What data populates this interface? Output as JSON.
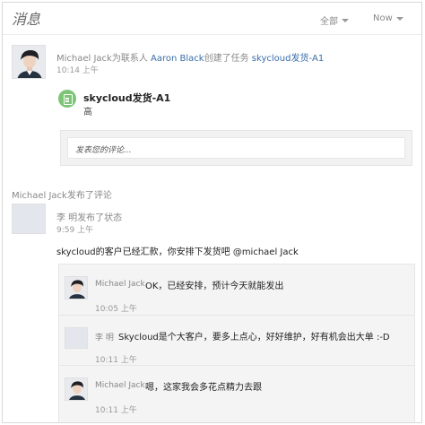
{
  "header": {
    "title": "消息",
    "filter_all": "全部",
    "filter_now": "Now"
  },
  "notification_1": {
    "actor": "Michael Jack",
    "action_prefix": "为联系人",
    "contact": "Aaron Black",
    "action_suffix": "创建了任务",
    "task_link": "skycloud发货-A1",
    "time": "10:14 上午",
    "task": {
      "icon": "task-icon",
      "title": "skycloud发货-A1",
      "priority": "高"
    },
    "comment_placeholder": "发表您的评论..."
  },
  "notification_2": {
    "heading": "Michael Jack发布了评论",
    "author_line": "李 明发布了状态",
    "time": "9:59 上午",
    "status": "skycloud的客户已经汇款，你安排下发货吧 @michael Jack",
    "replies": [
      {
        "name": "Michael Jack",
        "text": "OK，已经安排，预计今天就能发出",
        "time": "10:05 上午",
        "avatar": "photo"
      },
      {
        "name": "李 明",
        "text": "Skycloud是个大客户，要多上点心，好好维护，好有机会出大单 :-D",
        "time": "10:11 上午",
        "avatar": "placeholder"
      },
      {
        "name": "Michael Jack",
        "text": "嗯，这家我会多花点精力去跟",
        "time": "10:11 上午",
        "avatar": "photo"
      }
    ]
  },
  "colors": {
    "link": "#3a6ea8",
    "task_icon": "#7cc576",
    "muted_text": "#888888"
  }
}
